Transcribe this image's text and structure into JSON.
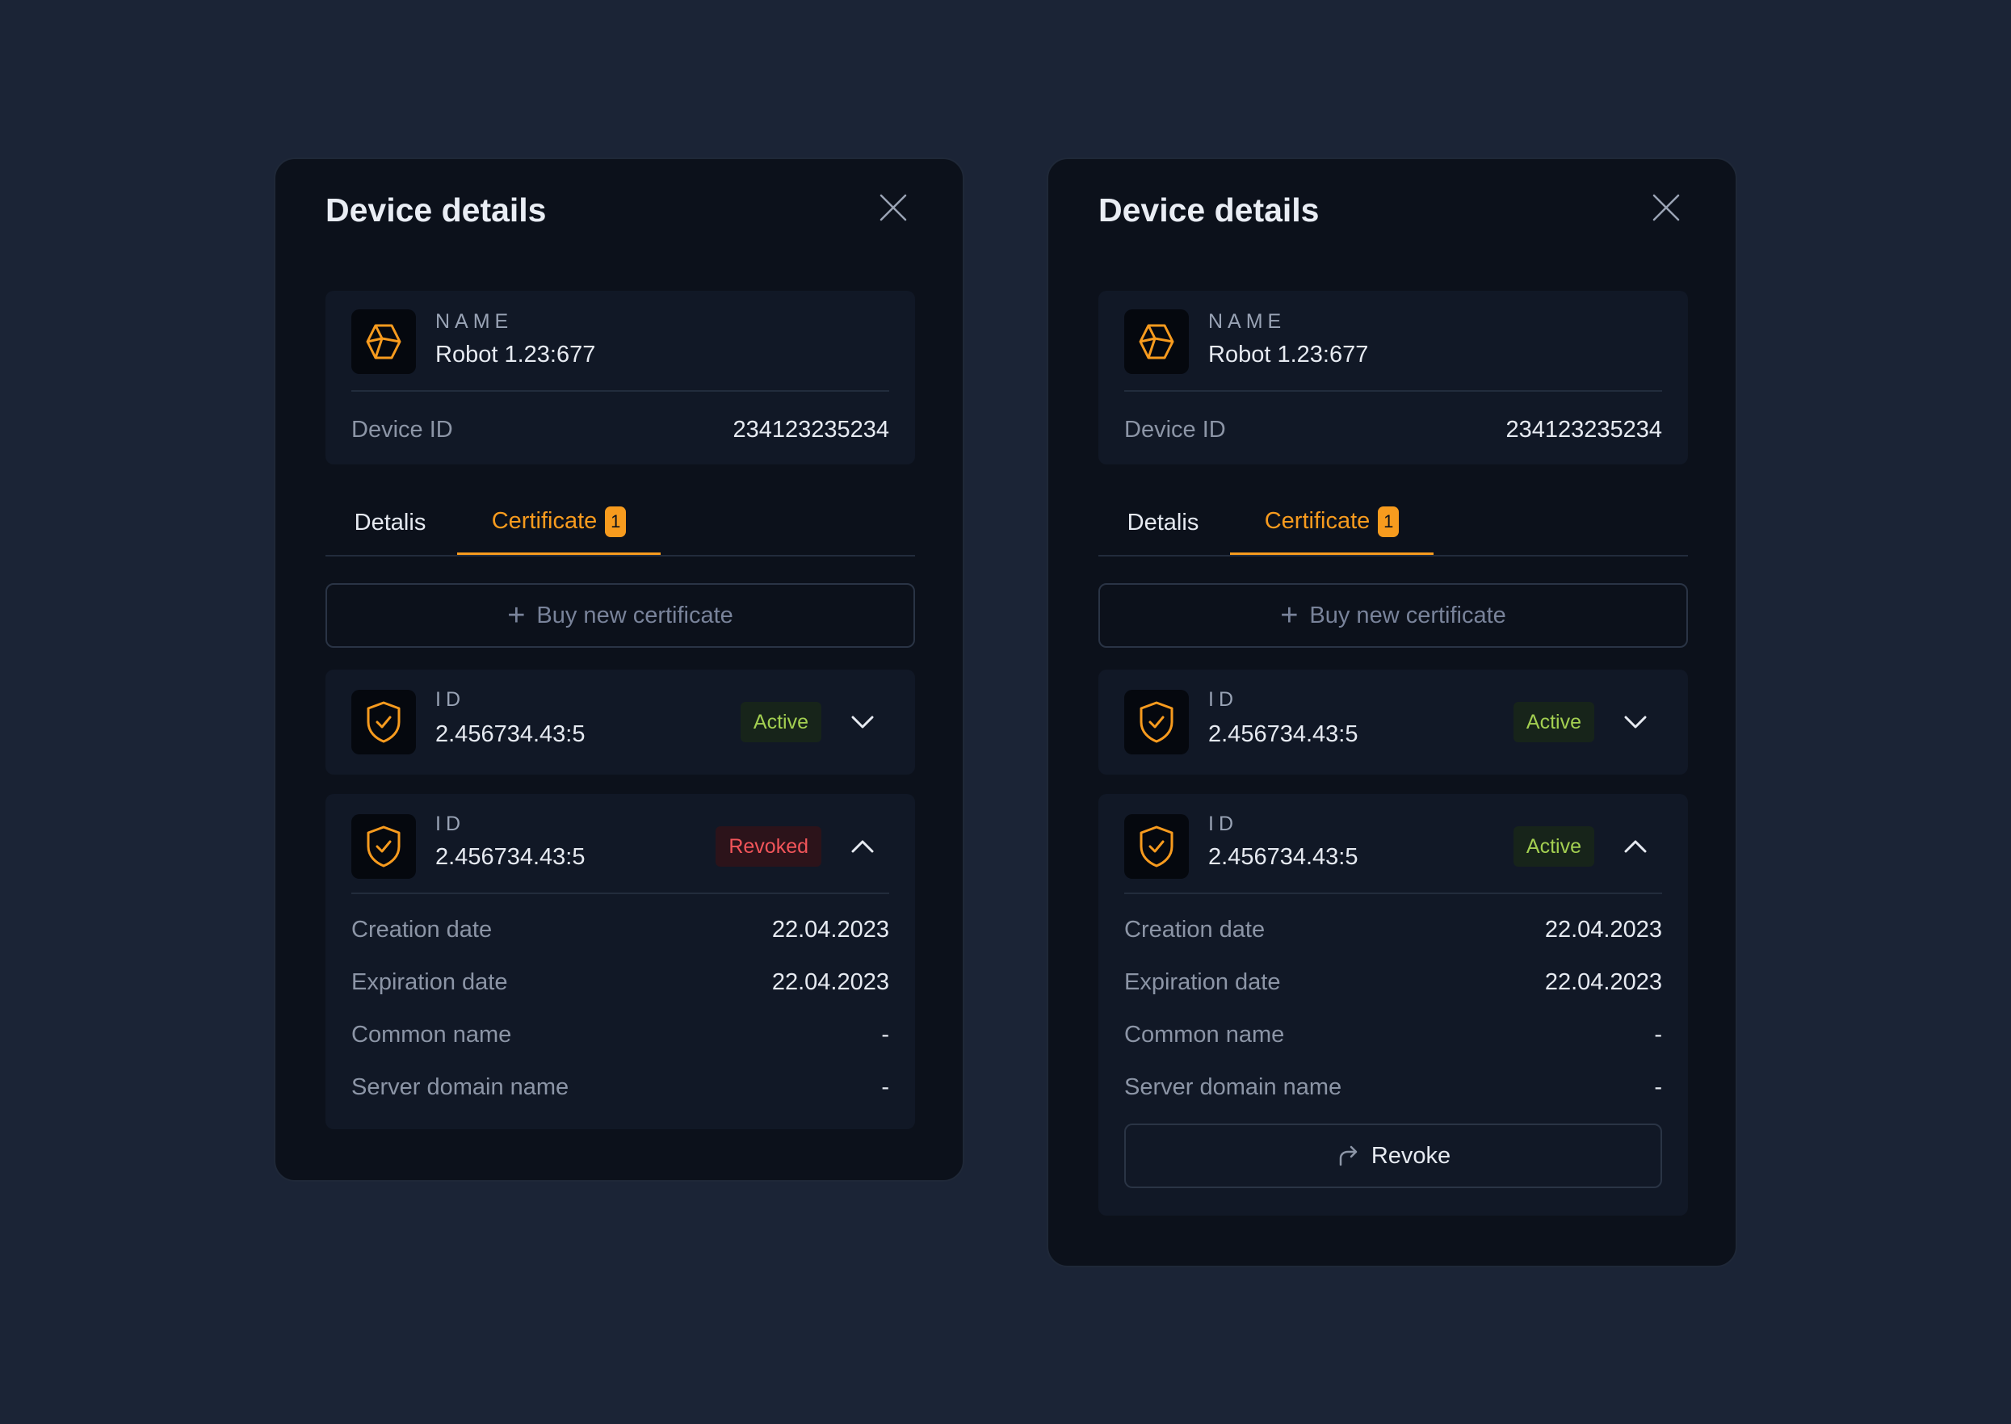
{
  "colors": {
    "background": "#1b2436",
    "panel": "#0c111b",
    "card": "#111826",
    "accent": "#f79b1e",
    "active": "#a3cf51",
    "revoked": "#f2555a"
  },
  "panels": [
    {
      "title": "Device details",
      "device": {
        "name_label": "NAME",
        "name": "Robot 1.23:677",
        "id_label": "Device ID",
        "id_value": "234123235234",
        "icon": "cube-icon"
      },
      "tabs": [
        {
          "label": "Detalis"
        },
        {
          "label": "Certificate",
          "badge": "1"
        }
      ],
      "buy_label": "Buy new certificate",
      "certificates": [
        {
          "id_label": "ID",
          "id": "2.456734.43:5",
          "status": "Active",
          "expanded": false
        },
        {
          "id_label": "ID",
          "id": "2.456734.43:5",
          "status": "Revoked",
          "expanded": true,
          "details": [
            {
              "label": "Creation date",
              "value": "22.04.2023"
            },
            {
              "label": "Expiration date",
              "value": "22.04.2023"
            },
            {
              "label": "Common name",
              "value": "-"
            },
            {
              "label": "Server domain name",
              "value": "-"
            }
          ]
        }
      ]
    },
    {
      "title": "Device details",
      "device": {
        "name_label": "NAME",
        "name": "Robot 1.23:677",
        "id_label": "Device ID",
        "id_value": "234123235234",
        "icon": "cube-icon"
      },
      "tabs": [
        {
          "label": "Detalis"
        },
        {
          "label": "Certificate",
          "badge": "1"
        }
      ],
      "buy_label": "Buy new certificate",
      "certificates": [
        {
          "id_label": "ID",
          "id": "2.456734.43:5",
          "status": "Active",
          "expanded": false
        },
        {
          "id_label": "ID",
          "id": "2.456734.43:5",
          "status": "Active",
          "expanded": true,
          "details": [
            {
              "label": "Creation date",
              "value": "22.04.2023"
            },
            {
              "label": "Expiration date",
              "value": "22.04.2023"
            },
            {
              "label": "Common name",
              "value": "-"
            },
            {
              "label": "Server domain name",
              "value": "-"
            }
          ],
          "revoke_label": "Revoke"
        }
      ]
    }
  ]
}
